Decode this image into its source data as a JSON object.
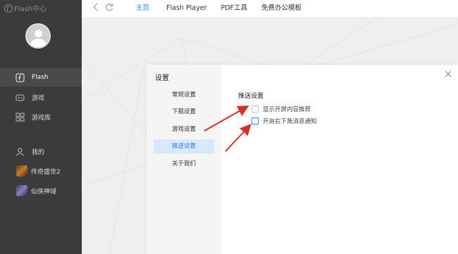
{
  "app": {
    "logo_text": "Flash中心"
  },
  "sidebar": {
    "items": [
      {
        "label": "Flash",
        "icon": "flash-icon",
        "active": true
      },
      {
        "label": "游戏",
        "icon": "gamepad-icon"
      },
      {
        "label": "游戏库",
        "icon": "grid-icon"
      },
      {
        "label": "我的",
        "icon": "user-icon"
      },
      {
        "label": "传奇盛世2",
        "icon": "game-thumb"
      },
      {
        "label": "仙侠神域",
        "icon": "game-thumb"
      }
    ]
  },
  "topbar": {
    "tabs": [
      {
        "label": "主页",
        "active": true
      },
      {
        "label": "Flash Player"
      },
      {
        "label": "PDF工具"
      },
      {
        "label": "免费办公模板"
      }
    ]
  },
  "settings": {
    "title": "设置",
    "items": [
      {
        "label": "常规设置"
      },
      {
        "label": "下载设置"
      },
      {
        "label": "游戏设置"
      },
      {
        "label": "推送设置",
        "active": true
      },
      {
        "label": "关于我们"
      }
    ],
    "section_title": "推送设置",
    "options": [
      {
        "label": "显示开屏内容推荐",
        "checked": false
      },
      {
        "label": "开启右下角消息通知",
        "checked": false
      }
    ]
  },
  "colors": {
    "accent": "#2b7cf0",
    "sidebar_bg": "#3b3b3d",
    "annotation_arrow": "#d62d2d"
  }
}
